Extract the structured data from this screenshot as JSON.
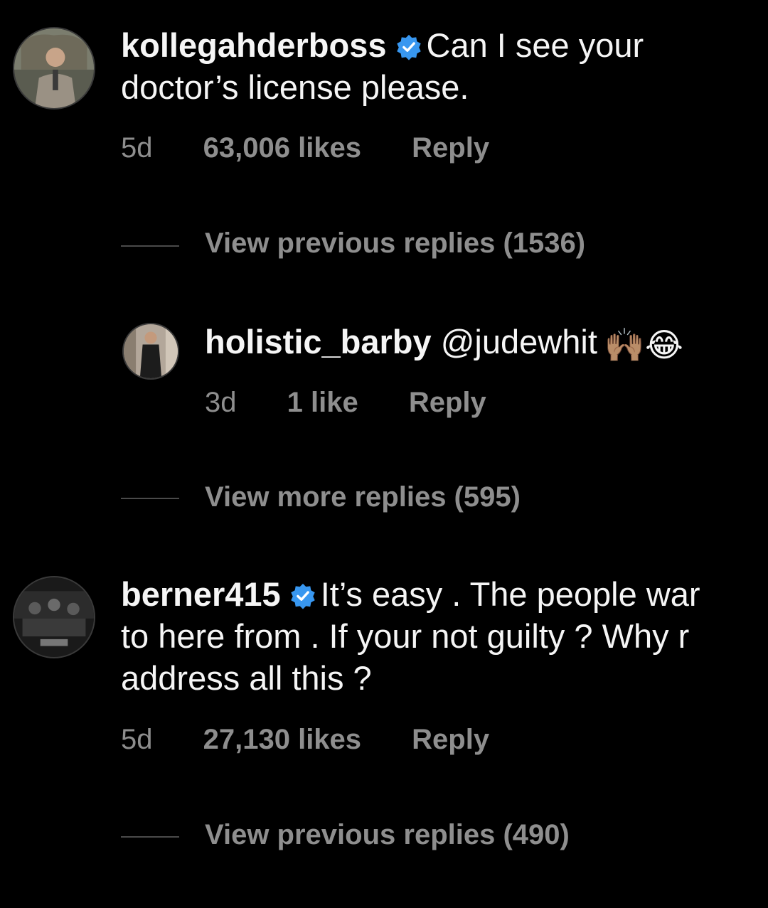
{
  "comments": [
    {
      "username": "kollegahderboss",
      "verified": true,
      "text_line1": "Can I see your",
      "text_line2": "doctor’s license please.",
      "time": "5d",
      "likes": "63,006 likes",
      "reply": "Reply",
      "replies_link": "View previous replies (1536)"
    },
    {
      "username": "holistic_barby",
      "mention": "@judewhit",
      "emojis": "🙌🏽😂",
      "time": "3d",
      "likes": "1 like",
      "reply": "Reply",
      "replies_link": "View more replies (595)"
    },
    {
      "username": "berner415",
      "verified": true,
      "text_line1": "It’s easy . The people war",
      "text_line2": "to here from . If your not guilty ? Why r",
      "text_line3": "address all this ?",
      "time": "5d",
      "likes": "27,130 likes",
      "reply": "Reply",
      "replies_link": "View previous replies (490)"
    }
  ],
  "colors": {
    "background": "#000000",
    "primary_text": "#f5f5f5",
    "secondary_text": "#8e8e8e",
    "verified_badge": "#3897f0"
  },
  "icons": [
    "verified-badge-icon"
  ]
}
